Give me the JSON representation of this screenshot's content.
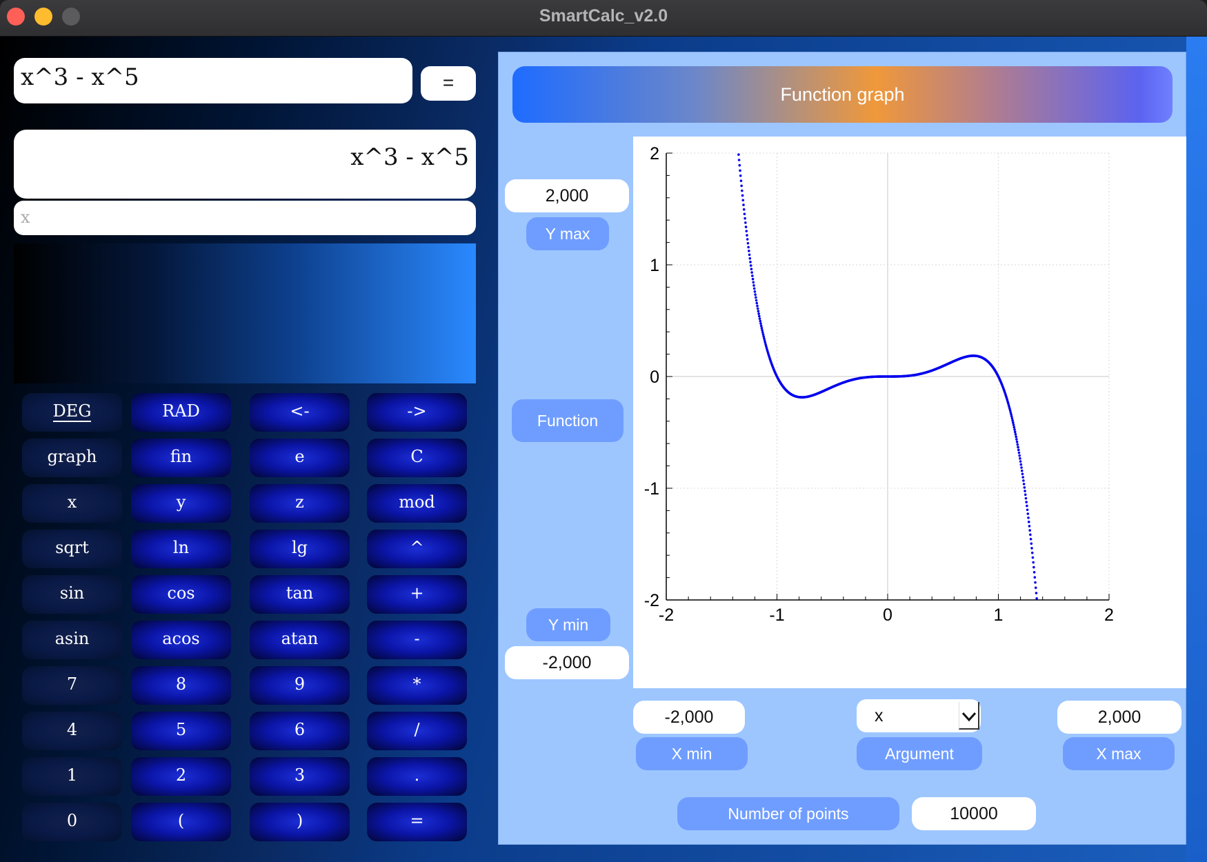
{
  "window": {
    "title": "SmartCalc_v2.0"
  },
  "calc": {
    "expression": "x^3 - x^5",
    "equals_label": "=",
    "display": "x^3 - x^5",
    "argument_placeholder": "x"
  },
  "keys": [
    [
      "DEG",
      "RAD",
      "<-",
      "->"
    ],
    [
      "graph",
      "fin",
      "e",
      "C"
    ],
    [
      "x",
      "y",
      "z",
      "mod"
    ],
    [
      "sqrt",
      "ln",
      "lg",
      "^"
    ],
    [
      "sin",
      "cos",
      "tan",
      "+"
    ],
    [
      "asin",
      "acos",
      "atan",
      "-"
    ],
    [
      "7",
      "8",
      "9",
      "*"
    ],
    [
      "4",
      "5",
      "6",
      "/"
    ],
    [
      "1",
      "2",
      "3",
      "."
    ],
    [
      "0",
      "(",
      ")",
      "="
    ]
  ],
  "graph": {
    "header": "Function graph",
    "ymax_value": "2,000",
    "ymax_label": "Y max",
    "function_label": "Function",
    "ymin_label": "Y min",
    "ymin_value": "-2,000",
    "xmin_value": "-2,000",
    "xmin_label": "X min",
    "argument_value": "x",
    "argument_label": "Argument",
    "xmax_value": "2,000",
    "xmax_label": "X max",
    "points_label": "Number of points",
    "points_value": "10000"
  },
  "chart_data": {
    "type": "scatter",
    "function": "x^3 - x^5",
    "xlim": [
      -2,
      2
    ],
    "ylim": [
      -2,
      2
    ],
    "x_ticks": [
      "-2",
      "-1",
      "0",
      "1",
      "2"
    ],
    "y_ticks": [
      "2",
      "1",
      "0",
      "-1",
      "-2"
    ],
    "grid": true,
    "color": "#0000ee"
  }
}
